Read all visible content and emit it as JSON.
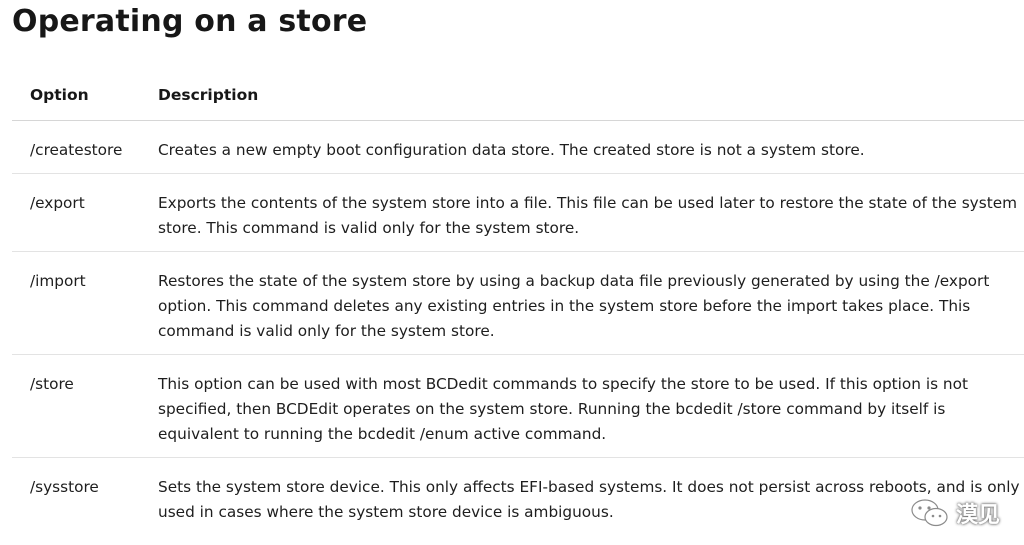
{
  "page": {
    "title": "Operating on a store"
  },
  "table": {
    "headers": {
      "option": "Option",
      "description": "Description"
    },
    "rows": [
      {
        "option": "/createstore",
        "description": "Creates a new empty boot configuration data store. The created store is not a system store."
      },
      {
        "option": "/export",
        "description": "Exports the contents of the system store into a file. This file can be used later to restore the state of the system store. This command is valid only for the system store."
      },
      {
        "option": "/import",
        "description": "Restores the state of the system store by using a backup data file previously generated by using the /export option. This command deletes any existing entries in the system store before the import takes place. This command is valid only for the system store."
      },
      {
        "option": "/store",
        "description": "This option can be used with most BCDedit commands to specify the store to be used. If this option is not specified, then BCDEdit operates on the system store. Running the bcdedit /store command by itself is equivalent to running the bcdedit /enum active command."
      },
      {
        "option": "/sysstore",
        "description": "Sets the system store device. This only affects EFI-based systems. It does not persist across reboots, and is only used in cases where the system store device is ambiguous."
      }
    ]
  },
  "watermark": {
    "icon": "wechat-icon",
    "text": "漠见"
  }
}
